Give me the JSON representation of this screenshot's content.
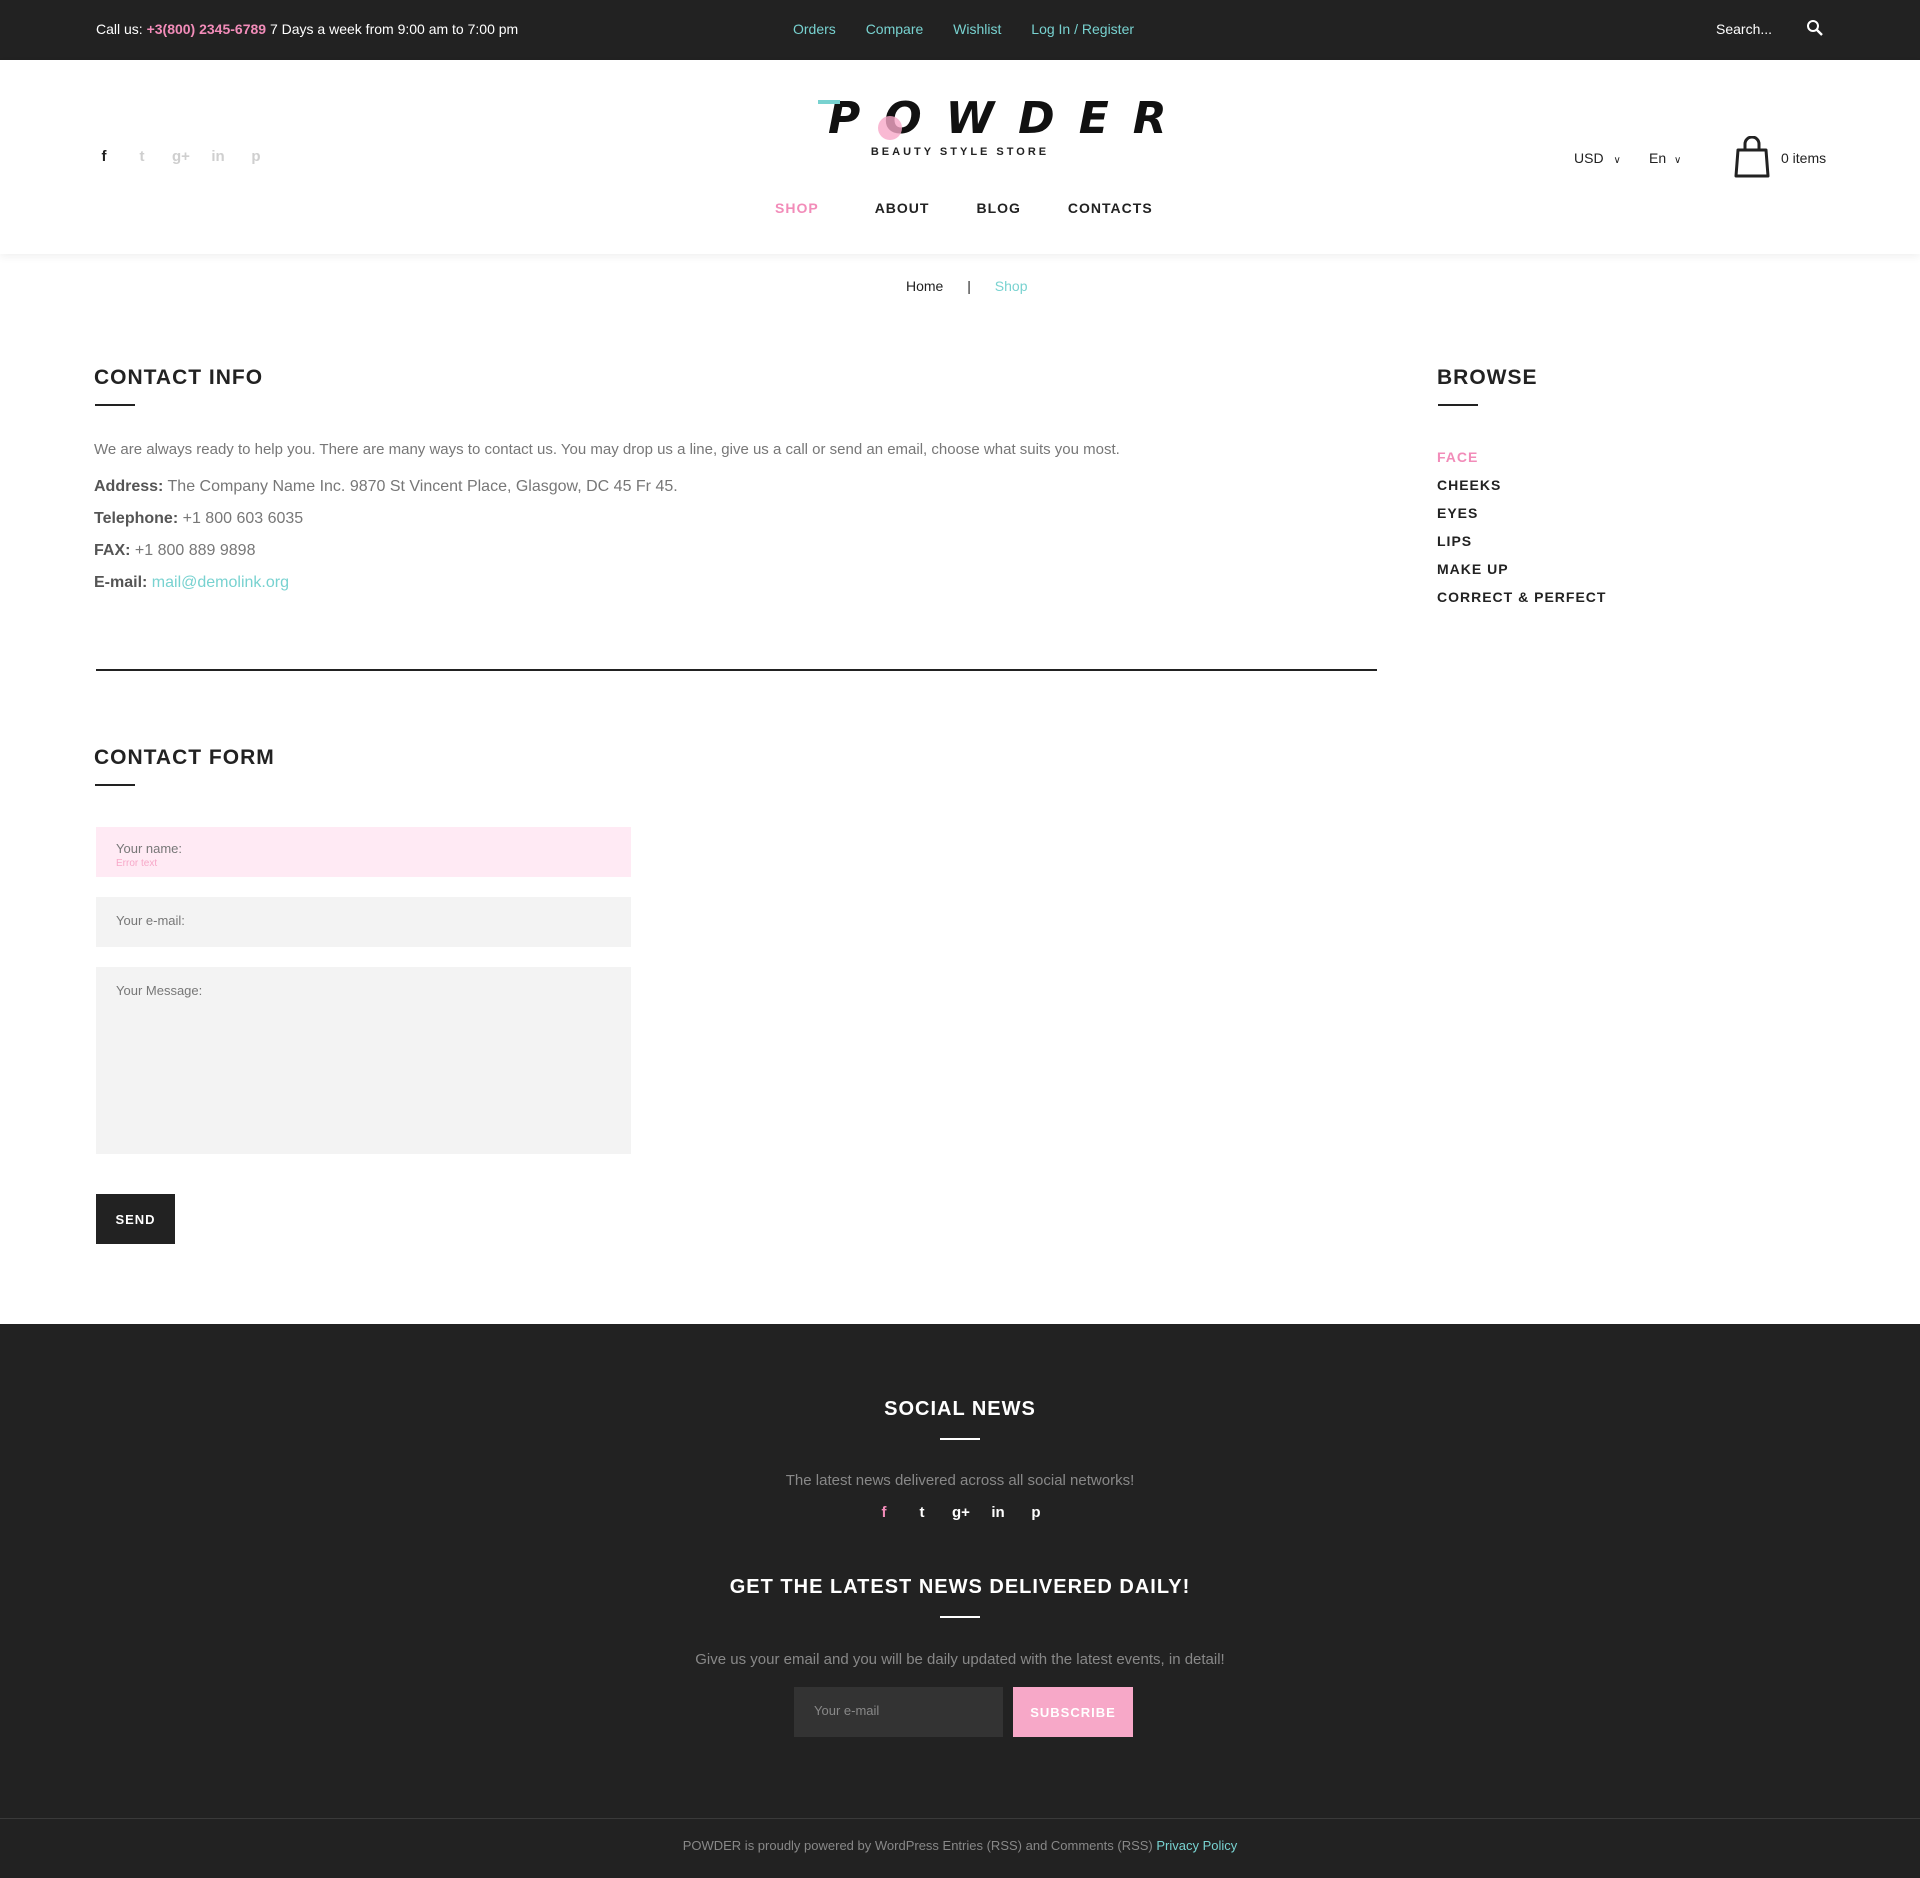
{
  "topbar": {
    "call_label": "Call us:",
    "phone": "+3(800) 2345-6789",
    "hours": "7 Days a week from 9:00 am to 7:00 pm",
    "links": [
      "Orders",
      "Compare",
      "Wishlist",
      "Log In / Register"
    ],
    "search_placeholder": "Search..."
  },
  "header": {
    "logo_text": "POWDER",
    "logo_tagline": "BEAUTY STYLE STORE",
    "nav": [
      "SHOP",
      "ABOUT",
      "BLOG",
      "CONTACTS"
    ],
    "currency": "USD",
    "language": "En",
    "cart_count": "0 items",
    "socials": [
      "facebook-icon",
      "twitter-icon",
      "google-plus-icon",
      "linkedin-icon",
      "pinterest-icon"
    ]
  },
  "breadcrumb": {
    "home": "Home",
    "separator": "|",
    "current": "Shop"
  },
  "contact_info": {
    "title": "CONTACT INFO",
    "intro": "We are always ready to help you. There are many ways to contact us. You may drop us a line, give us a call or send an email, choose what suits you most.",
    "address_label": "Address:",
    "address": "The Company Name Inc. 9870 St Vincent Place, Glasgow, DC 45 Fr 45.",
    "telephone_label": "Telephone:",
    "telephone": "+1 800 603 6035",
    "fax_label": "FAX:",
    "fax": "+1 800 889 9898",
    "email_label": "E-mail:",
    "email": "mail@demolink.org"
  },
  "browse": {
    "title": "BROWSE",
    "items": [
      "FACE",
      "CHEEKS",
      "EYES",
      "LIPS",
      "MAKE UP",
      "CORRECT & PERFECT"
    ]
  },
  "contact_form": {
    "title": "CONTACT FORM",
    "name_placeholder": "Your name:",
    "name_error": "Error text",
    "email_placeholder": "Your e-mail:",
    "message_placeholder": "Your Message:",
    "send_label": "SEND"
  },
  "footer": {
    "social_title": "SOCIAL NEWS",
    "social_text": "The latest news delivered across all social networks!",
    "news_title": "GET THE LATEST NEWS DELIVERED DAILY!",
    "news_text": "Give us your email and you will be daily updated with the latest events, in detail!",
    "email_placeholder": "Your e-mail",
    "subscribe_label": "SUBSCRIBE",
    "copyright": "POWDER is proudly powered by WordPress Entries (RSS) and Comments (RSS)",
    "privacy": "Privacy Policy"
  },
  "colors": {
    "accent_teal": "#78d2d0",
    "accent_pink": "#f28cb9",
    "dark": "#222222"
  }
}
